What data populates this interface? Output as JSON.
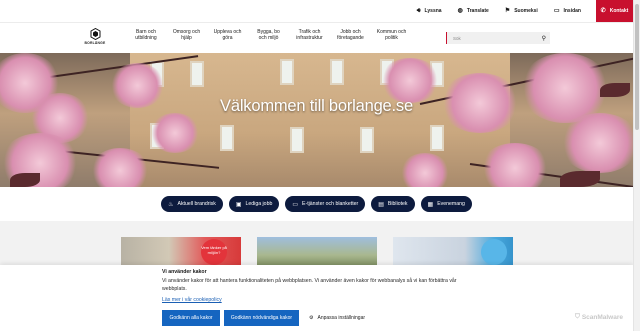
{
  "topbar": {
    "links": [
      {
        "label": "Lyssna",
        "icon": "speaker-icon"
      },
      {
        "label": "Translate",
        "icon": "globe-icon"
      },
      {
        "label": "Suomeksi",
        "icon": "flag-icon"
      },
      {
        "label": "Insidan",
        "icon": "monitor-icon"
      }
    ],
    "contact_label": "Kontakt"
  },
  "header": {
    "logo_text": "BORLÄNGE",
    "nav": [
      {
        "line1": "Barn och",
        "line2": "utbildning"
      },
      {
        "line1": "Omsorg och",
        "line2": "hjälp"
      },
      {
        "line1": "Uppleva och",
        "line2": "göra"
      },
      {
        "line1": "Bygga, bo",
        "line2": "och miljö"
      },
      {
        "line1": "Trafik och",
        "line2": "infrastruktur"
      },
      {
        "line1": "Jobb och",
        "line2": "företagande"
      },
      {
        "line1": "Kommun och",
        "line2": "politik"
      }
    ],
    "search_placeholder": "Sök"
  },
  "hero": {
    "title": "Välkommen till borlange.se"
  },
  "quick_links": [
    {
      "label": "Aktuell brandrisk",
      "icon": "flame-icon"
    },
    {
      "label": "Lediga jobb",
      "icon": "briefcase-icon"
    },
    {
      "label": "E-tjänster och blanketter",
      "icon": "laptop-icon"
    },
    {
      "label": "Bibliotek",
      "icon": "book-icon"
    },
    {
      "label": "Evenemang",
      "icon": "calendar-icon"
    }
  ],
  "cards": {
    "card1_badge": "Vem tänker på miljön?"
  },
  "cookie": {
    "title": "Vi använder kakor",
    "text": "Vi använder kakor för att hantera funktionaliteten på webbplatsen. Vi använder även kakor för webbanalys så vi kan förbättra vår webbplats.",
    "link": "Läs mer i vår cookiepolicy",
    "accept_all": "Godkänn alla kakor",
    "accept_needed": "Godkänn nödvändiga kakor",
    "adjust": "Anpassa inställningar"
  },
  "watermark": "ScanMalware",
  "colors": {
    "accent_red": "#c8102e",
    "navy": "#0d1b3e",
    "button_blue": "#1565c0"
  }
}
